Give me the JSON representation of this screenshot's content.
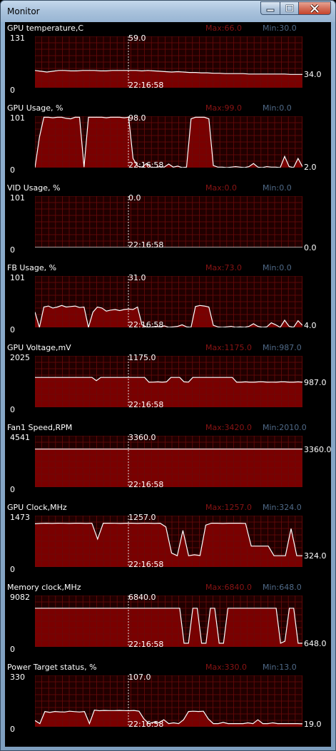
{
  "window": {
    "title": "Monitor",
    "controls": {
      "minimize": "minimize-icon",
      "maximize": "maximize-icon",
      "close": "close-icon"
    },
    "colors": {
      "plot_bg": "#2a0000",
      "fill": "#7a0000",
      "grid": "#5e0000",
      "line": "#ffffff",
      "max_text": "#8a1414",
      "min_text": "#506a88"
    }
  },
  "panels": [
    {
      "label": "GPU temperature,C",
      "max": "Max:66.0",
      "min": "Min:30.0",
      "ymax": "131",
      "ymin": "0",
      "current": "59.0",
      "time": "22:16:58",
      "last": "34.0",
      "yrange": [
        0,
        131
      ],
      "values": [
        44,
        42,
        40,
        42,
        44,
        44,
        43,
        43,
        44,
        44,
        44,
        43,
        43,
        44,
        44,
        44,
        44,
        44,
        43,
        44,
        43,
        42,
        41,
        40,
        41,
        40,
        39,
        39,
        38,
        38,
        37,
        37,
        36,
        36,
        36,
        36,
        35,
        35,
        35,
        35,
        35,
        35,
        35,
        34,
        34,
        34
      ]
    },
    {
      "label": "GPU Usage, %",
      "max": "Max:99.0",
      "min": "Min:0.0",
      "ymax": "101",
      "ymin": "0",
      "current": "98.0",
      "time": "22:16:58",
      "last": "2.0",
      "yrange": [
        0,
        101
      ],
      "values": [
        0,
        60,
        99,
        99,
        98,
        99,
        99,
        97,
        96,
        99,
        99,
        1,
        99,
        99,
        99,
        99,
        98,
        99,
        99,
        99,
        98,
        99,
        18,
        3,
        1,
        8,
        1,
        0,
        2,
        1,
        7,
        1,
        3,
        0,
        1,
        96,
        99,
        99,
        99,
        96,
        4,
        1,
        1,
        0,
        1,
        2,
        1,
        0,
        2,
        8,
        1,
        0,
        2,
        1,
        1,
        0,
        22,
        2,
        0,
        18,
        2
      ]
    },
    {
      "label": "VID Usage, %",
      "max": "Max:0.0",
      "min": "Min:0.0",
      "ymax": "101",
      "ymin": "0",
      "current": "0.0",
      "time": "22:16:58",
      "last": "0.0",
      "yrange": [
        0,
        101
      ],
      "values": [
        0,
        0,
        0,
        0,
        0,
        0,
        0,
        0,
        0,
        0
      ]
    },
    {
      "label": "FB Usage, %",
      "max": "Max:73.0",
      "min": "Min:0.0",
      "ymax": "101",
      "ymin": "0",
      "current": "31.0",
      "time": "22:16:58",
      "last": "4.0",
      "yrange": [
        0,
        101
      ],
      "values": [
        30,
        0,
        40,
        42,
        38,
        40,
        43,
        40,
        41,
        42,
        39,
        40,
        0,
        30,
        40,
        38,
        32,
        34,
        35,
        33,
        35,
        36,
        35,
        40,
        5,
        1,
        0,
        2,
        1,
        3,
        0,
        1,
        2,
        5,
        1,
        0,
        41,
        43,
        42,
        40,
        4,
        1,
        0,
        1,
        2,
        0,
        1,
        0,
        2,
        7,
        2,
        0,
        1,
        9,
        5,
        0,
        14,
        2,
        0,
        13,
        4
      ]
    },
    {
      "label": "GPU Voltage,mV",
      "max": "Max:1175.0",
      "min": "Min:987.0",
      "ymax": "2025",
      "ymin": "0",
      "current": "1175.0",
      "time": "22:16:58",
      "last": "987.0",
      "yrange": [
        0,
        2025
      ],
      "values": [
        1175,
        1175,
        1175,
        1175,
        1175,
        1175,
        1175,
        1175,
        1175,
        1175,
        1175,
        1175,
        1175,
        1175,
        1050,
        1175,
        1175,
        1175,
        1175,
        1175,
        1175,
        1175,
        1175,
        1175,
        1175,
        1175,
        987,
        990,
        1000,
        987,
        1000,
        1175,
        1175,
        1175,
        1000,
        990,
        1175,
        1175,
        1175,
        1175,
        1175,
        1175,
        1175,
        1175,
        1175,
        1175,
        987,
        987,
        1000,
        987,
        987,
        1000,
        1000,
        987,
        990,
        987,
        1000,
        1000,
        987,
        987,
        1000,
        987
      ]
    },
    {
      "label": "Fan1 Speed,RPM",
      "max": "Max:3420.0",
      "min": "Min:2010.0",
      "ymax": "4541",
      "ymin": "0",
      "current": "3360.0",
      "time": "22:16:58",
      "last": "3360.0",
      "yrange": [
        0,
        4541
      ],
      "values": [
        3360,
        3360,
        3360,
        3360,
        3360,
        3360,
        3360,
        3360,
        3360,
        3360,
        3360,
        3360,
        3360,
        3360,
        3360,
        3360,
        3360,
        3360,
        3360,
        3360,
        3360,
        3360,
        3360,
        3360,
        3360,
        3360,
        3360,
        3360,
        3360,
        3360,
        3360,
        3360,
        3360,
        3360,
        3360,
        3360,
        3360,
        3360,
        3360,
        3360,
        3360,
        3360,
        3360,
        3360,
        3360,
        3360,
        3360,
        3360,
        3360,
        3360,
        3360
      ]
    },
    {
      "label": "GPU Clock,MHz",
      "max": "Max:1257.0",
      "min": "Min:324.0",
      "ymax": "1473",
      "ymin": "0",
      "current": "1257.0",
      "time": "22:16:58",
      "last": "324.0",
      "yrange": [
        0,
        1473
      ],
      "values": [
        1240,
        1250,
        1257,
        1250,
        1257,
        1255,
        1250,
        1257,
        1257,
        1250,
        1257,
        800,
        1257,
        1257,
        1255,
        1250,
        1257,
        1257,
        1250,
        1257,
        1257,
        1250,
        1257,
        1150,
        400,
        324,
        1050,
        324,
        350,
        330,
        1200,
        1257,
        1257,
        1250,
        1257,
        1257,
        1257,
        1250,
        600,
        600,
        600,
        600,
        324,
        324,
        324,
        1100,
        324,
        324
      ]
    },
    {
      "label": "Memory clock,MHz",
      "max": "Max:6840.0",
      "min": "Min:648.0",
      "ymax": "9082",
      "ymin": "0",
      "current": "6840.0",
      "time": "22:16:58",
      "last": "648.0",
      "yrange": [
        0,
        9082
      ],
      "values": [
        6840,
        6840,
        6840,
        6840,
        6840,
        6840,
        6840,
        6840,
        6840,
        6840,
        6840,
        6840,
        6840,
        6840,
        6840,
        6840,
        6840,
        6840,
        6840,
        6840,
        6840,
        6840,
        6840,
        6840,
        6840,
        6840,
        6840,
        6840,
        6840,
        6840,
        6840,
        6840,
        6840,
        6840,
        648,
        648,
        6840,
        6840,
        648,
        648,
        6840,
        6840,
        648,
        648,
        6840,
        6840,
        6840,
        6840,
        6840,
        6840,
        6840,
        6840,
        6840,
        6840,
        6840,
        6840,
        648,
        1000,
        6840,
        6840,
        648,
        648
      ]
    },
    {
      "label": "Power Target status, %",
      "max": "Max:330.0",
      "min": "Min:13.0",
      "ymax": "330",
      "ymin": "0",
      "current": "107.0",
      "time": "22:16:58",
      "last": "19.0",
      "yrange": [
        0,
        330
      ],
      "values": [
        40,
        20,
        98,
        92,
        98,
        96,
        95,
        100,
        97,
        95,
        98,
        20,
        107,
        103,
        105,
        104,
        104,
        105,
        104,
        103,
        105,
        100,
        50,
        20,
        30,
        25,
        45,
        20,
        25,
        20,
        45,
        98,
        100,
        98,
        100,
        50,
        20,
        20,
        28,
        20,
        20,
        20,
        20,
        25,
        20,
        45,
        20,
        20,
        25,
        20,
        20,
        20,
        20,
        20,
        19
      ]
    }
  ]
}
